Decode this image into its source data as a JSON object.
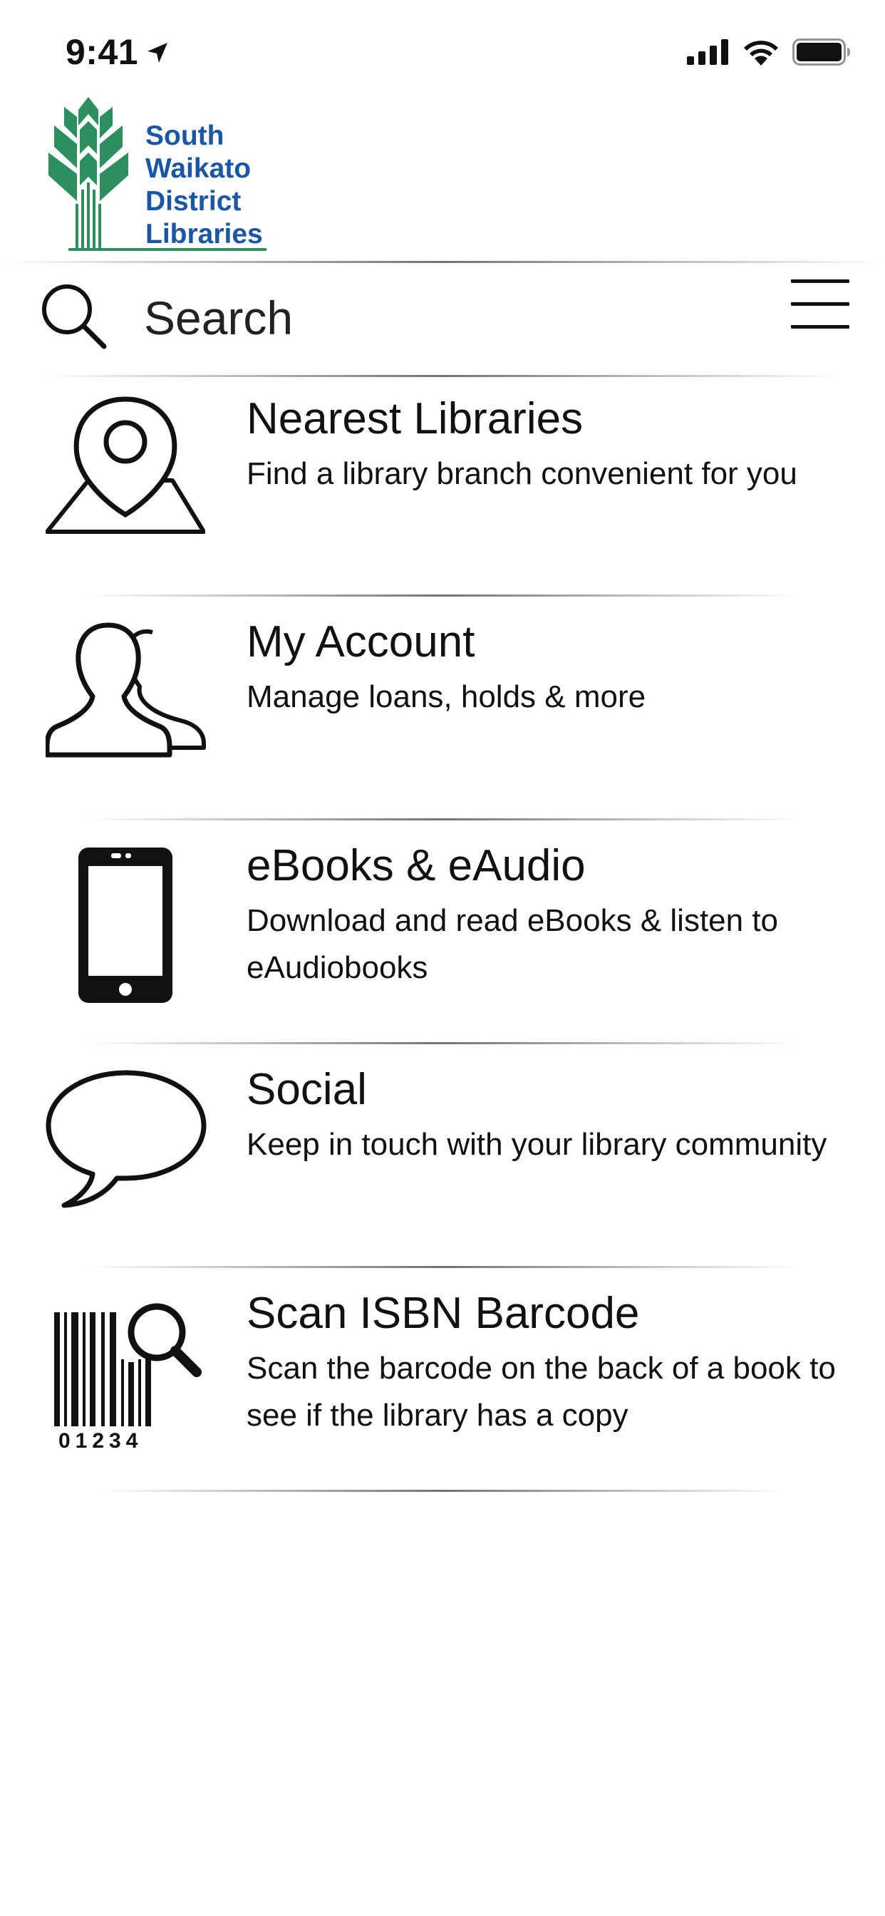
{
  "status_bar": {
    "time": "9:41"
  },
  "brand": {
    "lines": [
      "South",
      "Waikato",
      "District",
      "Libraries"
    ],
    "text_color": "#1a56a6",
    "mark_color": "#2e8f5e"
  },
  "search": {
    "placeholder": "Search"
  },
  "menu_items": [
    {
      "title": "Nearest Libraries",
      "description": "Find a library branch convenient for you",
      "icon": "map-pin-icon"
    },
    {
      "title": "My Account",
      "description": "Manage loans, holds & more",
      "icon": "users-icon"
    },
    {
      "title": "eBooks & eAudio",
      "description": "Download and read eBooks & listen to eAudiobooks",
      "icon": "phone-icon"
    },
    {
      "title": "Social",
      "description": "Keep in touch with your library community",
      "icon": "speech-bubble-icon"
    },
    {
      "title": "Scan ISBN Barcode",
      "description": "Scan the barcode on the back of a book to see if the library has a copy",
      "icon": "barcode-scan-icon",
      "barcode_digits": "01234"
    }
  ]
}
